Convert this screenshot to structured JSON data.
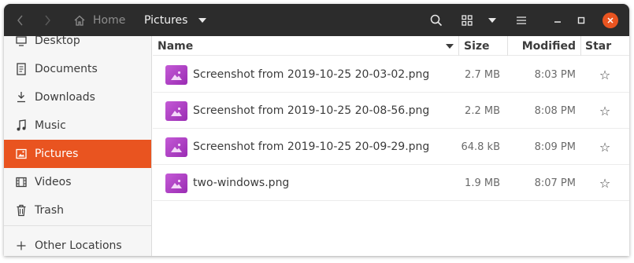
{
  "header": {
    "home_label": "Home",
    "current_folder": "Pictures"
  },
  "sidebar": {
    "items": [
      {
        "label": "Desktop",
        "icon": "desktop-icon"
      },
      {
        "label": "Documents",
        "icon": "documents-icon"
      },
      {
        "label": "Downloads",
        "icon": "downloads-icon"
      },
      {
        "label": "Music",
        "icon": "music-icon"
      },
      {
        "label": "Pictures",
        "icon": "pictures-icon",
        "active": true
      },
      {
        "label": "Videos",
        "icon": "videos-icon"
      },
      {
        "label": "Trash",
        "icon": "trash-icon"
      }
    ],
    "other_locations": "Other Locations"
  },
  "columns": {
    "name": "Name",
    "size": "Size",
    "modified": "Modified",
    "star": "Star"
  },
  "files": [
    {
      "name": "Screenshot from 2019-10-25 20-03-02.png",
      "size": "2.7 MB",
      "modified": "8:03 PM",
      "star": "☆"
    },
    {
      "name": "Screenshot from 2019-10-25 20-08-56.png",
      "size": "2.2 MB",
      "modified": "8:08 PM",
      "star": "☆"
    },
    {
      "name": "Screenshot from 2019-10-25 20-09-29.png",
      "size": "64.8 kB",
      "modified": "8:09 PM",
      "star": "☆"
    },
    {
      "name": "two-windows.png",
      "size": "1.9 MB",
      "modified": "8:07 PM",
      "star": "☆"
    }
  ],
  "colors": {
    "accent": "#e95420",
    "headerbar": "#2c2c2c",
    "thumbnail": "#b048c9"
  }
}
